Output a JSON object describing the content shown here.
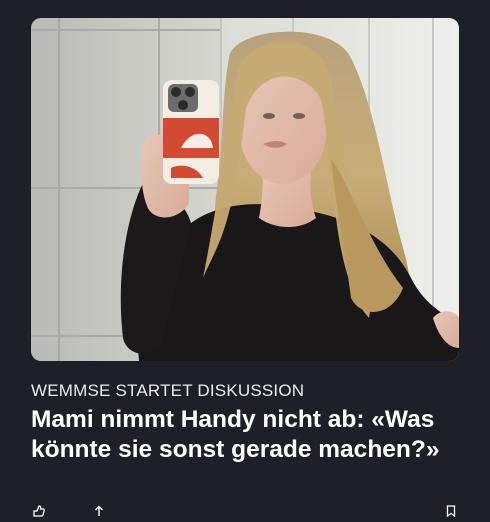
{
  "article": {
    "kicker": "WEMMSE STARTET DISKUSSION",
    "headline": "Mami nimmt Handy nicht ab: «Was könnte sie sonst gerade machen?»",
    "image": {
      "subject": "mirror-selfie-photo"
    }
  },
  "actions": {
    "icons": [
      "like-icon",
      "share-icon",
      "bookmark-icon"
    ]
  },
  "colors": {
    "background": "#1d2127",
    "text": "#ffffff",
    "kicker": "#e9ebee"
  }
}
